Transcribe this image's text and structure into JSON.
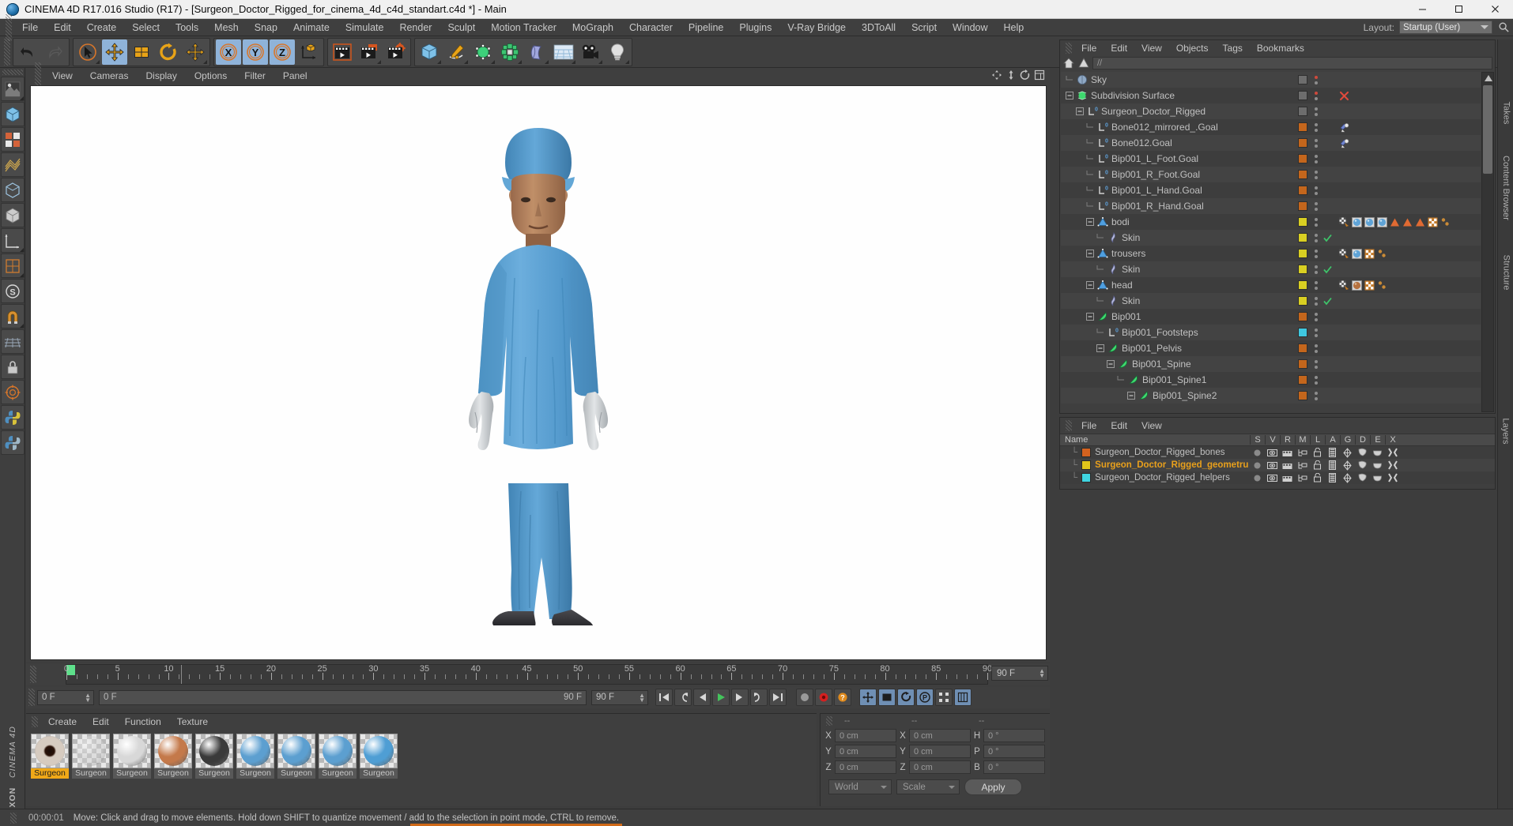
{
  "window": {
    "title": "CINEMA 4D R17.016 Studio (R17) - [Surgeon_Doctor_Rigged_for_cinema_4d_c4d_standart.c4d *] - Main",
    "minimize": "–",
    "maximize": "☐",
    "close": "✕"
  },
  "menubar": {
    "items": [
      "File",
      "Edit",
      "Create",
      "Select",
      "Tools",
      "Mesh",
      "Snap",
      "Animate",
      "Simulate",
      "Render",
      "Sculpt",
      "Motion Tracker",
      "MoGraph",
      "Character",
      "Pipeline",
      "Plugins",
      "V-Ray Bridge",
      "3DToAll",
      "Script",
      "Window",
      "Help"
    ],
    "layout_label": "Layout:",
    "layout_value": "Startup (User)",
    "search_icon": "search-icon"
  },
  "toolbar": {
    "groups": [
      {
        "name": "undo-redo",
        "buttons": [
          {
            "name": "undo-button",
            "icon": "undo-icon"
          },
          {
            "name": "redo-button",
            "icon": "redo-icon"
          }
        ]
      },
      {
        "name": "transform-tools",
        "buttons": [
          {
            "name": "live-selection-tool",
            "icon": "cursor-icon"
          },
          {
            "name": "move-tool",
            "icon": "move-icon"
          },
          {
            "name": "scale-tool",
            "icon": "scale-icon"
          },
          {
            "name": "rotate-tool",
            "icon": "rotate-icon"
          },
          {
            "name": "transform-tool",
            "icon": "move-icon"
          }
        ]
      },
      {
        "name": "axis-locks",
        "buttons": [
          {
            "name": "x-axis-lock",
            "icon": "x-axis-icon"
          },
          {
            "name": "y-axis-lock",
            "icon": "y-axis-icon"
          },
          {
            "name": "z-axis-lock",
            "icon": "z-axis-icon"
          },
          {
            "name": "world-object-coordinates",
            "icon": "world-axis-icon"
          }
        ]
      },
      {
        "name": "render-tools",
        "buttons": [
          {
            "name": "render-view-button",
            "icon": "clapboard-icon"
          },
          {
            "name": "render-region-button",
            "icon": "clapboard-region-icon"
          },
          {
            "name": "render-settings-button",
            "icon": "clapboard-gear-icon"
          }
        ]
      },
      {
        "name": "create-tools",
        "buttons": [
          {
            "name": "add-cube-button",
            "icon": "cube-icon"
          },
          {
            "name": "add-spline-button",
            "icon": "pen-icon"
          },
          {
            "name": "add-generator-button",
            "icon": "hyper-nurbs-icon"
          },
          {
            "name": "add-array-button",
            "icon": "array-icon"
          },
          {
            "name": "add-deformer-button",
            "icon": "bend-icon"
          },
          {
            "name": "add-scene-button",
            "icon": "floor-icon"
          },
          {
            "name": "add-camera-button",
            "icon": "camera-icon"
          },
          {
            "name": "add-light-button",
            "icon": "light-icon"
          }
        ]
      }
    ]
  },
  "left_palette": {
    "buttons": [
      {
        "name": "tool-texture",
        "icon": "texture-icon"
      },
      {
        "name": "tool-model-mode",
        "icon": "model-mode-icon"
      },
      {
        "name": "tool-object-mode",
        "icon": "object-mode-icon"
      },
      {
        "name": "tool-polygon-mode",
        "icon": "polygon-mode-icon"
      },
      {
        "name": "tool-edge-mode",
        "icon": "edge-mode-icon"
      },
      {
        "name": "tool-point-mode",
        "icon": "point-mode-icon"
      },
      {
        "name": "tool-axis-mode",
        "icon": "axis-mode-icon"
      },
      {
        "name": "tool-uv-mode",
        "icon": "uv-mode-icon"
      },
      {
        "name": "tool-subdivision",
        "icon": "subdivision-icon"
      },
      {
        "name": "tool-snap",
        "icon": "magnet-icon"
      },
      {
        "name": "tool-workplane",
        "icon": "workplane-icon"
      },
      {
        "name": "tool-lock-workplane",
        "icon": "lock-icon"
      },
      {
        "name": "tool-quantize",
        "icon": "quantize-icon"
      },
      {
        "name": "tool-python",
        "icon": "python-icon"
      },
      {
        "name": "tool-script",
        "icon": "script-icon"
      }
    ],
    "brand_line1": "MAXON",
    "brand_line2": "CINEMA 4D"
  },
  "viewport": {
    "menu": [
      "View",
      "Cameras",
      "Display",
      "Options",
      "Filter",
      "Panel"
    ],
    "corner_icons": [
      "pan-icon",
      "zoom-icon",
      "rotate-icon",
      "maximize-view-icon"
    ],
    "background": "#ffffff",
    "content_description": "Surgeon figure in blue scrubs and cap standing facing camera"
  },
  "timeline": {
    "ticks": [
      0,
      5,
      10,
      15,
      20,
      25,
      30,
      35,
      40,
      45,
      50,
      55,
      60,
      65,
      70,
      75,
      80,
      85,
      90
    ],
    "current_frame": 0,
    "end_frame_label": "90 F",
    "frame_field": "0 F",
    "range_start": "0 F",
    "range_end": "90 F",
    "preview_end": "90 F"
  },
  "transport": {
    "buttons": [
      {
        "name": "go-to-start-button",
        "icon": "skip-start-icon"
      },
      {
        "name": "go-to-previous-key-button",
        "icon": "prev-key-icon"
      },
      {
        "name": "go-to-previous-frame-button",
        "icon": "prev-frame-icon"
      },
      {
        "name": "play-button",
        "icon": "play-icon"
      },
      {
        "name": "go-to-next-frame-button",
        "icon": "next-frame-icon"
      },
      {
        "name": "go-to-next-key-button",
        "icon": "next-key-icon"
      },
      {
        "name": "go-to-end-button",
        "icon": "skip-end-icon"
      },
      {
        "name": "record-active-objects-button",
        "icon": "record-circle-icon"
      },
      {
        "name": "autokeying-button",
        "icon": "autokey-icon"
      },
      {
        "name": "keyframe-selection-button",
        "icon": "question-icon"
      },
      {
        "name": "position-key-toggle",
        "icon": "move-key-icon"
      },
      {
        "name": "scale-key-toggle",
        "icon": "scale-key-icon"
      },
      {
        "name": "rotation-key-toggle",
        "icon": "rotate-key-icon"
      },
      {
        "name": "parameter-key-toggle",
        "icon": "param-key-icon"
      },
      {
        "name": "point-level-animation-toggle",
        "icon": "pla-icon"
      },
      {
        "name": "timeline-toggle",
        "icon": "timeline-icon"
      }
    ]
  },
  "material_manager": {
    "menu": [
      "Create",
      "Edit",
      "Function",
      "Texture"
    ],
    "materials": [
      {
        "name": "Surgeon",
        "label": "Surgeon",
        "color": "#d6cbc0",
        "active": true,
        "type": "eye"
      },
      {
        "name": "Surgeon",
        "label": "Surgeon",
        "color": "#cfcfcf",
        "active": false,
        "type": "glass"
      },
      {
        "name": "Surgeon",
        "label": "Surgeon",
        "color": "#d8d8d8",
        "active": false,
        "type": "white"
      },
      {
        "name": "Surgeon",
        "label": "Surgeon",
        "color": "#c4794a",
        "active": false,
        "type": "skin"
      },
      {
        "name": "Surgeon",
        "label": "Surgeon",
        "color": "#3a3a3a",
        "active": false,
        "type": "dark"
      },
      {
        "name": "Surgeon",
        "label": "Surgeon",
        "color": "#5c9fd0",
        "active": false,
        "type": "blue"
      },
      {
        "name": "Surgeon",
        "label": "Surgeon",
        "color": "#5c9fd0",
        "active": false,
        "type": "blue"
      },
      {
        "name": "Surgeon",
        "label": "Surgeon",
        "color": "#5c9fd0",
        "active": false,
        "type": "blue"
      },
      {
        "name": "Surgeon",
        "label": "Surgeon",
        "color": "#4f9ed4",
        "active": false,
        "type": "blue"
      }
    ]
  },
  "coordinates": {
    "header_dashes": [
      "--",
      "--",
      "--"
    ],
    "rows": [
      {
        "label_pos": "X",
        "value_pos": "0 cm",
        "label_size": "X",
        "value_size": "0 cm",
        "label_rot": "H",
        "value_rot": "0 °"
      },
      {
        "label_pos": "Y",
        "value_pos": "0 cm",
        "label_size": "Y",
        "value_size": "0 cm",
        "label_rot": "P",
        "value_rot": "0 °"
      },
      {
        "label_pos": "Z",
        "value_pos": "0 cm",
        "label_size": "Z",
        "value_size": "0 cm",
        "label_rot": "B",
        "value_rot": "0 °"
      }
    ],
    "system": "World",
    "mode": "Scale",
    "apply": "Apply"
  },
  "statusbar": {
    "time": "00:00:01",
    "message": "Move: Click and drag to move elements. Hold down SHIFT to quantize movement / add to the selection in point mode, CTRL to remove.",
    "progress_color": "#d06a18"
  },
  "object_manager": {
    "menu": [
      "File",
      "Edit",
      "View",
      "Objects",
      "Tags",
      "Bookmarks"
    ],
    "path": "//",
    "home_icon": "home-icon",
    "up_icon": "up-arrow-icon",
    "rows": [
      {
        "label": "Sky",
        "indent": 0,
        "icon": "sky-icon",
        "expander": "none",
        "color": "#6d6d6d",
        "dotcolor": "#cf4a3c",
        "tags": []
      },
      {
        "label": "Subdivision Surface",
        "indent": 0,
        "icon": "subdiv-icon",
        "expander": "minus",
        "color": "#6d6d6d",
        "dotcolor": "#cf4a3c",
        "tags": [
          "x-mark"
        ]
      },
      {
        "label": "Surgeon_Doctor_Rigged",
        "indent": 1,
        "icon": "null-icon",
        "expander": "minus",
        "color": "#6d6d6d",
        "tags": []
      },
      {
        "label": "Bone012_mirrored_.Goal",
        "indent": 2,
        "icon": "null-icon",
        "expander": "none",
        "color": "#c4661c",
        "tags": [
          "constraint"
        ]
      },
      {
        "label": "Bone012.Goal",
        "indent": 2,
        "icon": "null-icon",
        "expander": "none",
        "color": "#c4661c",
        "tags": [
          "constraint"
        ]
      },
      {
        "label": "Bip001_L_Foot.Goal",
        "indent": 2,
        "icon": "null-icon",
        "expander": "none",
        "color": "#c4661c",
        "tags": []
      },
      {
        "label": "Bip001_R_Foot.Goal",
        "indent": 2,
        "icon": "null-icon",
        "expander": "none",
        "color": "#c4661c",
        "tags": []
      },
      {
        "label": "Bip001_L_Hand.Goal",
        "indent": 2,
        "icon": "null-icon",
        "expander": "none",
        "color": "#c4661c",
        "tags": []
      },
      {
        "label": "Bip001_R_Hand.Goal",
        "indent": 2,
        "icon": "null-icon",
        "expander": "none",
        "color": "#c4661c",
        "tags": []
      },
      {
        "label": "bodi",
        "indent": 2,
        "icon": "polygon-icon",
        "expander": "minus",
        "color": "#d9cf22",
        "tags": [
          "selection",
          "mat-blue",
          "mat-blue",
          "mat-blue",
          "tri",
          "tri",
          "tri",
          "uvw",
          "dots"
        ]
      },
      {
        "label": "Skin",
        "indent": 3,
        "icon": "skin-icon",
        "expander": "none",
        "color": "#d9cf22",
        "check": true,
        "tags": []
      },
      {
        "label": "trousers",
        "indent": 2,
        "icon": "polygon-icon",
        "expander": "minus",
        "color": "#d9cf22",
        "tags": [
          "selection",
          "mat-blue",
          "uvw",
          "dots"
        ]
      },
      {
        "label": "Skin",
        "indent": 3,
        "icon": "skin-icon",
        "expander": "none",
        "color": "#d9cf22",
        "check": true,
        "tags": []
      },
      {
        "label": "head",
        "indent": 2,
        "icon": "polygon-icon",
        "expander": "minus",
        "color": "#d9cf22",
        "tags": [
          "selection",
          "mat-skin",
          "uvw",
          "dots"
        ]
      },
      {
        "label": "Skin",
        "indent": 3,
        "icon": "skin-icon",
        "expander": "none",
        "color": "#d9cf22",
        "check": true,
        "tags": []
      },
      {
        "label": "Bip001",
        "indent": 2,
        "icon": "joint-icon",
        "expander": "minus",
        "color": "#c4661c",
        "tags": []
      },
      {
        "label": "Bip001_Footsteps",
        "indent": 3,
        "icon": "null-icon",
        "expander": "none",
        "color": "#3fc8e0",
        "tags": []
      },
      {
        "label": "Bip001_Pelvis",
        "indent": 3,
        "icon": "joint-icon",
        "expander": "minus",
        "color": "#c4661c",
        "tags": []
      },
      {
        "label": "Bip001_Spine",
        "indent": 4,
        "icon": "joint-icon",
        "expander": "minus",
        "color": "#c4661c",
        "tags": []
      },
      {
        "label": "Bip001_Spine1",
        "indent": 5,
        "icon": "joint-icon",
        "expander": "none",
        "color": "#c4661c",
        "tags": []
      },
      {
        "label": "Bip001_Spine2",
        "indent": 6,
        "icon": "joint-icon",
        "expander": "minus",
        "color": "#c4661c",
        "tags": []
      }
    ]
  },
  "layer_manager": {
    "menu": [
      "File",
      "Edit",
      "View"
    ],
    "columns": [
      "Name",
      "S",
      "V",
      "R",
      "M",
      "L",
      "A",
      "G",
      "D",
      "E",
      "X"
    ],
    "rows": [
      {
        "label": "Surgeon_Doctor_Rigged_bones",
        "color": "#d4621f",
        "selected": false
      },
      {
        "label": "Surgeon_Doctor_Rigged_geometru",
        "color": "#e0c51a",
        "selected": true
      },
      {
        "label": "Surgeon_Doctor_Rigged_helpers",
        "color": "#3fd4e0",
        "selected": false
      }
    ]
  },
  "right_dock": {
    "tabs": [
      "Takes",
      "Content Browser",
      "Structure",
      "Layers"
    ]
  }
}
